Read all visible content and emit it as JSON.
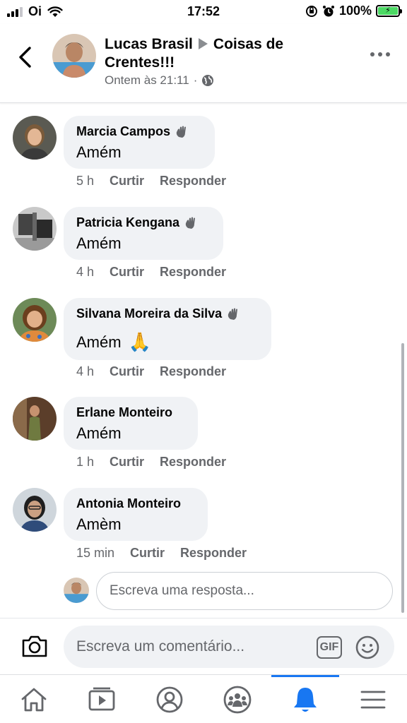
{
  "status_bar": {
    "carrier": "Oi",
    "time": "17:52",
    "battery": "100%"
  },
  "post": {
    "author": "Lucas Brasil",
    "group": "Coisas de Crentes!!!",
    "timestamp": "Ontem às 21:11",
    "privacy_icon": "globe-icon"
  },
  "comments": [
    {
      "name": "Marcia Campos",
      "badge_icon": "wave-icon",
      "text": "Amém",
      "emoji": "",
      "time": "5 h",
      "like": "Curtir",
      "reply": "Responder"
    },
    {
      "name": "Patricia Kengana",
      "badge_icon": "wave-icon",
      "text": "Amém",
      "emoji": "",
      "time": "4 h",
      "like": "Curtir",
      "reply": "Responder"
    },
    {
      "name": "Silvana Moreira da Silva",
      "badge_icon": "wave-icon",
      "text": "Amém",
      "emoji": "🙏",
      "time": "4 h",
      "like": "Curtir",
      "reply": "Responder"
    },
    {
      "name": "Erlane Monteiro",
      "badge_icon": "",
      "text": "Amém",
      "emoji": "",
      "time": "1 h",
      "like": "Curtir",
      "reply": "Responder"
    },
    {
      "name": "Antonia Monteiro",
      "badge_icon": "",
      "text": "Amèm",
      "emoji": "",
      "time": "15 min",
      "like": "Curtir",
      "reply": "Responder"
    }
  ],
  "reply_box": {
    "placeholder": "Escreva uma resposta..."
  },
  "composer": {
    "placeholder": "Escreva um comentário...",
    "gif_label": "GIF"
  },
  "tab_bar": {
    "tabs": [
      "home-icon",
      "video-icon",
      "profile-icon",
      "groups-icon",
      "notifications-icon",
      "menu-icon"
    ],
    "active": "notifications-icon"
  },
  "colors": {
    "accent": "#1877f2",
    "bubble": "#f0f2f5",
    "secondary_text": "#65676b",
    "battery": "#4cd964"
  }
}
